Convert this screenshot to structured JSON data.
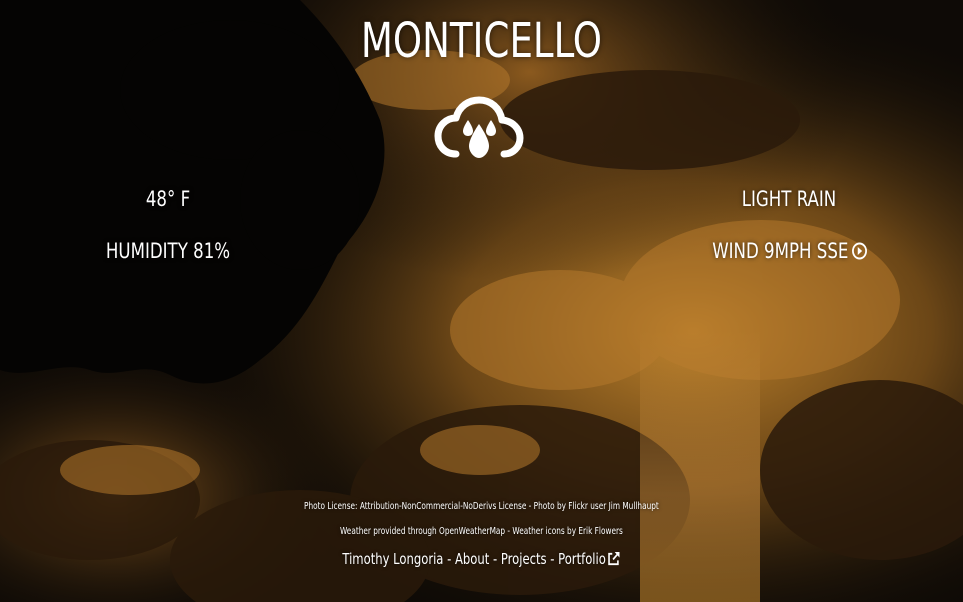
{
  "location": {
    "city": "MONTICELLO"
  },
  "current": {
    "icon": "rain-cloud-icon",
    "temperature": "48° F",
    "humidity": "HUMIDITY 81%",
    "description": "LIGHT RAIN",
    "wind": "WIND 9MPH SSE",
    "wind_icon": "wind-direction-arrow-icon"
  },
  "footer": {
    "photo_license": "Photo License: Attribution-NonCommercial-NoDerivs License - Photo by Flickr user Jim Mullhaupt",
    "weather_credit": "Weather provided through OpenWeatherMap - Weather icons by Erik Flowers",
    "links": {
      "name": "Timothy Longoria",
      "separator": " - ",
      "about": "About",
      "projects": "Projects",
      "portfolio": "Portfolio",
      "portfolio_icon": "external-link-icon"
    }
  },
  "colors": {
    "text": "#ffffff",
    "sky_glow": "#c98a2e",
    "sky_dark": "#0b0906"
  }
}
